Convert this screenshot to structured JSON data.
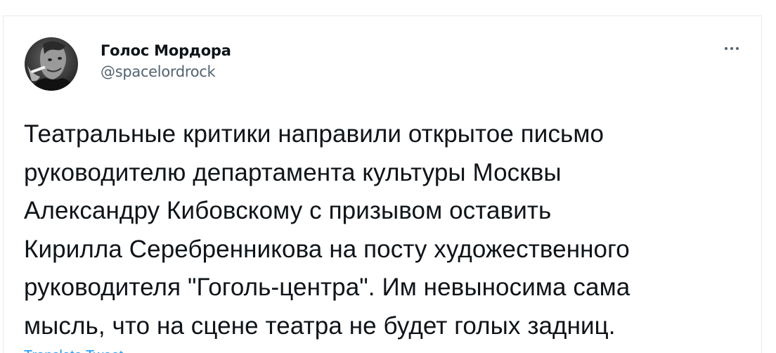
{
  "tweet": {
    "display_name": "Голос Мордора",
    "handle": "@spacelordrock",
    "text": "Театральные критики направили открытое письмо\nруководителю департамента культуры Москвы\nАлександру Кибовскому с призывом оставить\nКирилла Серебренникова на посту художественного\nруководителя \"Гоголь-центра\". Им невыносима сама\nмысль, что на сцене театра не будет голых задниц.",
    "translate_label": "Translate Tweet",
    "avatar_icon": "user-avatar-photo",
    "more_icon": "more-horizontal-icon"
  },
  "colors": {
    "text_primary": "#0f1419",
    "text_secondary": "#536471",
    "link": "#1d9bf0",
    "border": "#e6e9eb"
  }
}
